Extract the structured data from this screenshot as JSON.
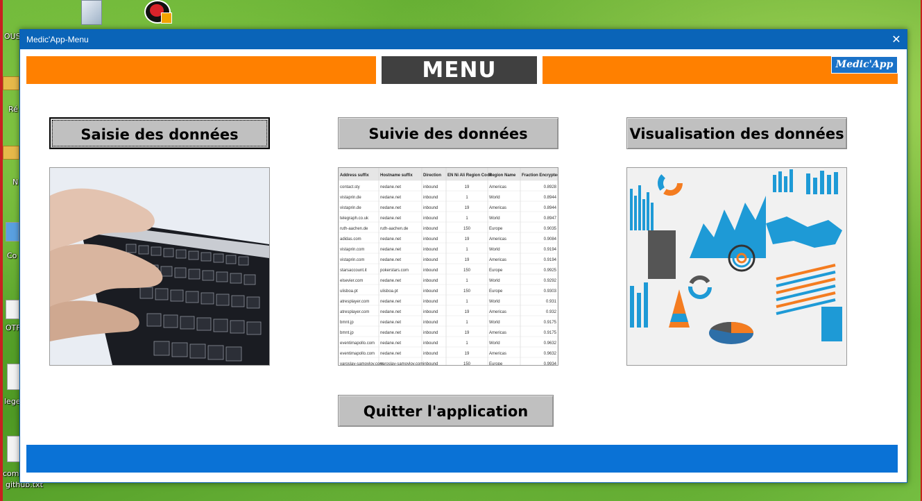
{
  "desktop": {
    "icons": [
      {
        "label": "OUS"
      },
      {
        "label": "Ré"
      },
      {
        "label": "N"
      },
      {
        "label": "Co"
      },
      {
        "label": "OTF"
      },
      {
        "label": "lege"
      },
      {
        "label": "com"
      },
      {
        "label": "github.txt"
      }
    ]
  },
  "window": {
    "title": "Medic'App-Menu",
    "close_glyph": "✕"
  },
  "header": {
    "menu_label": "MENU",
    "brand": "Medic'App",
    "accent_color": "#ff8000",
    "dark_color": "#404040",
    "brand_color": "#1a72c8"
  },
  "buttons": {
    "saisie": "Saisie des données",
    "suivie": "Suivie des données",
    "visualisation": "Visualisation des données",
    "quitter": "Quitter l'application"
  },
  "images": {
    "saisie": "keyboard-photo",
    "suivie": "spreadsheet-screenshot",
    "visualisation": "charts-infographic"
  },
  "table": {
    "headers": [
      "Address suffix",
      "Hostname suffix",
      "Direction",
      "EN Ni Ali Region Code",
      "Region Name",
      "Fraction Encrypted"
    ],
    "rows": [
      [
        "contact.sty",
        "nedane.net",
        "inbound",
        "19",
        "Americas",
        "0.8928"
      ],
      [
        "vistaprin.de",
        "nedane.net",
        "inbound",
        "1",
        "World",
        "0.8944"
      ],
      [
        "vistaprin.de",
        "nedane.net",
        "inbound",
        "19",
        "Americas",
        "0.8944"
      ],
      [
        "telegraph.co.uk",
        "nedane.net",
        "inbound",
        "1",
        "World",
        "0.8947"
      ],
      [
        "ruth-aachen.de",
        "ruth-aachen.de",
        "inbound",
        "150",
        "Europe",
        "0.9035"
      ],
      [
        "adidas.com",
        "nedane.net",
        "inbound",
        "19",
        "Americas",
        "0.9084"
      ],
      [
        "vistaprin.com",
        "nedane.net",
        "inbound",
        "1",
        "World",
        "0.9194"
      ],
      [
        "vistaprin.com",
        "nedane.net",
        "inbound",
        "19",
        "Americas",
        "0.9194"
      ],
      [
        "starsaccount.it",
        "pokerstars.com",
        "inbound",
        "150",
        "Europe",
        "0.9925"
      ],
      [
        "elsevier.com",
        "nedane.net",
        "inbound",
        "1",
        "World",
        "0.9292"
      ],
      [
        "ulisboa.pt",
        "ulisboa.pt",
        "inbound",
        "150",
        "Europe",
        "0.9303"
      ],
      [
        "atresplayer.com",
        "nedane.net",
        "inbound",
        "1",
        "World",
        "0.931"
      ],
      [
        "atresplayer.com",
        "nedane.net",
        "inbound",
        "19",
        "Americas",
        "0.932"
      ],
      [
        "bmnt.jp",
        "nedane.net",
        "inbound",
        "1",
        "World",
        "0.9175"
      ],
      [
        "bmnt.jp",
        "nedane.net",
        "inbound",
        "19",
        "Americas",
        "0.9175"
      ],
      [
        "eventimapollo.com",
        "nedane.net",
        "inbound",
        "1",
        "World",
        "0.9632"
      ],
      [
        "eventimapollo.com",
        "nedane.net",
        "inbound",
        "19",
        "Americas",
        "0.9632"
      ],
      [
        "yaroslav-samoylov.com",
        "yaroslav-samoylov.com",
        "inbound",
        "150",
        "Europe",
        "0.9934"
      ]
    ]
  }
}
